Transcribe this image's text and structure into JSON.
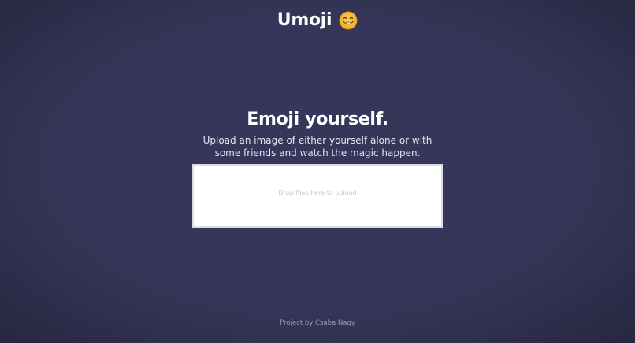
{
  "header": {
    "title": "Umoji",
    "icon": "grinning-face-icon"
  },
  "hero": {
    "title": "Emoji yourself.",
    "subtitle": "Upload an image of either yourself alone or with some friends and watch the magic happen."
  },
  "dropzone": {
    "prompt": "Drop files here to upload"
  },
  "footer": {
    "credit": "Project by Csaba Nagy"
  },
  "colors": {
    "background": "#36365a",
    "text": "#ffffff",
    "dropzone_bg": "#ffffff",
    "dropzone_text": "#c5c6cc",
    "footer_text": "#9fa0b8"
  }
}
